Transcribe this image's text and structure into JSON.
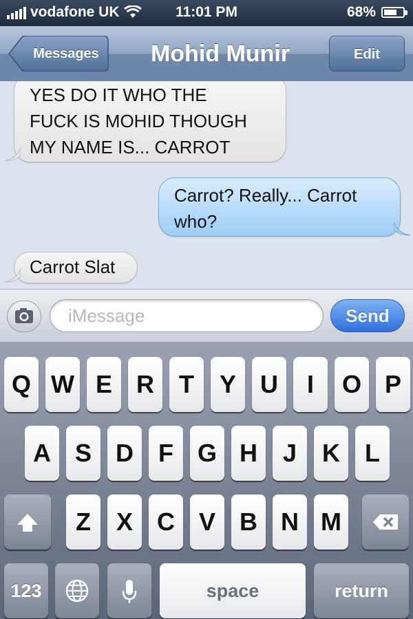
{
  "status_bar": {
    "carrier": "vodafone UK",
    "time": "11:01 PM",
    "battery": "68%",
    "battery_level": 0.68
  },
  "nav": {
    "back_label": "Messages",
    "title": "Mohid Munir",
    "edit_label": "Edit"
  },
  "messages": [
    {
      "direction": "received",
      "text_lines": [
        "YES DO IT WHO THE",
        "FUCK IS MOHID THOUGH",
        "MY NAME IS... CARROT"
      ]
    },
    {
      "direction": "sent",
      "text_lines": [
        "Carrot? Really... Carrot",
        "who?"
      ]
    },
    {
      "direction": "received",
      "text_lines": [
        "Carrot Slat"
      ]
    }
  ],
  "composer": {
    "placeholder": "iMessage",
    "send_label": "Send",
    "camera_icon": "camera-icon"
  },
  "keyboard": {
    "row1": [
      "Q",
      "W",
      "E",
      "R",
      "T",
      "Y",
      "U",
      "I",
      "O",
      "P"
    ],
    "row2": [
      "A",
      "S",
      "D",
      "F",
      "G",
      "H",
      "J",
      "K",
      "L"
    ],
    "row3": [
      "Z",
      "X",
      "C",
      "V",
      "B",
      "N",
      "M"
    ],
    "numbers_label": "123",
    "space_label": "space",
    "return_label": "return",
    "icons": {
      "shift": "shift-icon",
      "delete": "delete-icon",
      "globe": "globe-icon",
      "mic": "microphone-icon"
    }
  },
  "colors": {
    "sent_bubble": "#9ccdf6",
    "received_bubble": "#e3e3e3",
    "send_button": "#2f6fdb",
    "nav_bar": "#6f87a9"
  }
}
